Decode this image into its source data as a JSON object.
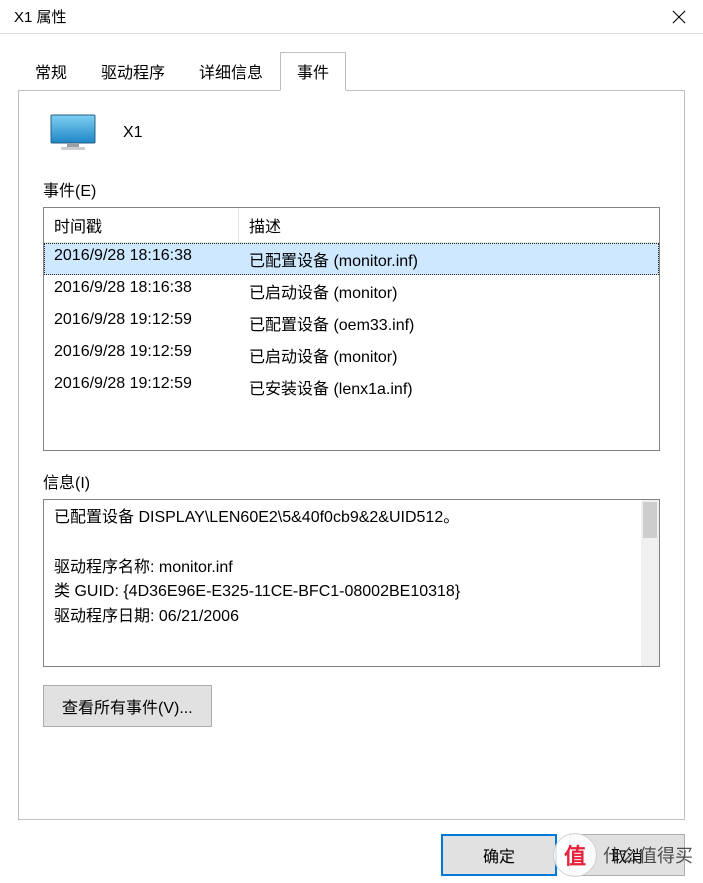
{
  "window": {
    "title": "X1 属性"
  },
  "tabs": [
    {
      "label": "常规"
    },
    {
      "label": "驱动程序"
    },
    {
      "label": "详细信息"
    },
    {
      "label": "事件"
    }
  ],
  "active_tab_index": 3,
  "device": {
    "name": "X1"
  },
  "events_section_label": "事件(E)",
  "events_columns": {
    "timestamp": "时间戳",
    "description": "描述"
  },
  "events": [
    {
      "timestamp": "2016/9/28 18:16:38",
      "description": "已配置设备 (monitor.inf)",
      "selected": true
    },
    {
      "timestamp": "2016/9/28 18:16:38",
      "description": "已启动设备 (monitor)",
      "selected": false
    },
    {
      "timestamp": "2016/9/28 19:12:59",
      "description": "已配置设备 (oem33.inf)",
      "selected": false
    },
    {
      "timestamp": "2016/9/28 19:12:59",
      "description": "已启动设备 (monitor)",
      "selected": false
    },
    {
      "timestamp": "2016/9/28 19:12:59",
      "description": "已安装设备 (lenx1a.inf)",
      "selected": false
    }
  ],
  "info_section_label": "信息(I)",
  "info_text": "已配置设备 DISPLAY\\LEN60E2\\5&40f0cb9&2&UID512。\n\n驱动程序名称: monitor.inf\n类 GUID: {4D36E96E-E325-11CE-BFC1-08002BE10318}\n驱动程序日期: 06/21/2006",
  "buttons": {
    "view_all": "查看所有事件(V)...",
    "ok": "确定",
    "cancel": "取消"
  },
  "watermark": {
    "glyph": "值",
    "text": "什么值得买"
  }
}
